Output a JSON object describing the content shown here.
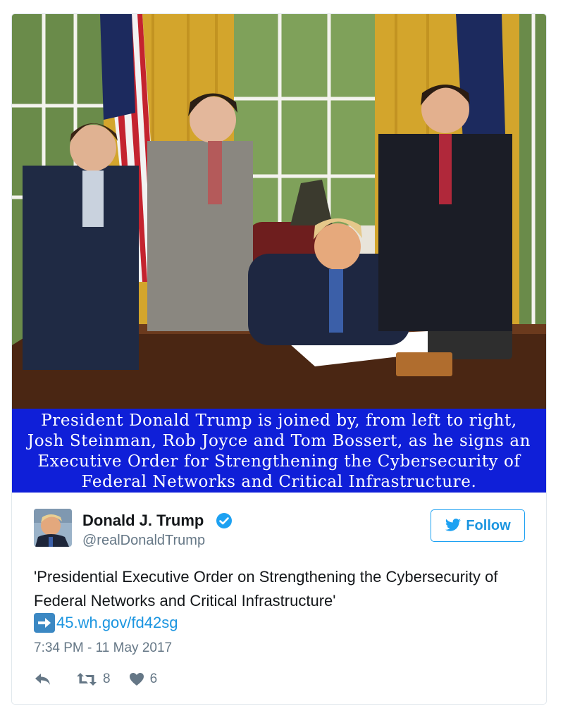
{
  "image": {
    "caption_lines": [
      "President Donald Trump is joined by, from left to right,",
      "Josh Steinman, Rob Joyce and Tom Bossert, as he signs an",
      "Executive Order for Strengthening the Cybersecurity of",
      "Federal Networks and Critical Infrastructure."
    ],
    "caption_bg": "#0f1fd8"
  },
  "tweet": {
    "author_name": "Donald J. Trump",
    "handle": "@realDonaldTrump",
    "follow_label": "Follow",
    "text": "'Presidential Executive Order on Strengthening the Cybersecurity of Federal Networks and Critical Infrastructure'",
    "link_icon": "right-arrow-emoji",
    "link": "45.wh.gov/fd42sg",
    "timestamp": "7:34 PM - 11 May 2017",
    "retweets": "8",
    "likes": "6"
  },
  "colors": {
    "accent": "#1da1f2",
    "link": "#1b95e0",
    "muted": "#657786"
  }
}
